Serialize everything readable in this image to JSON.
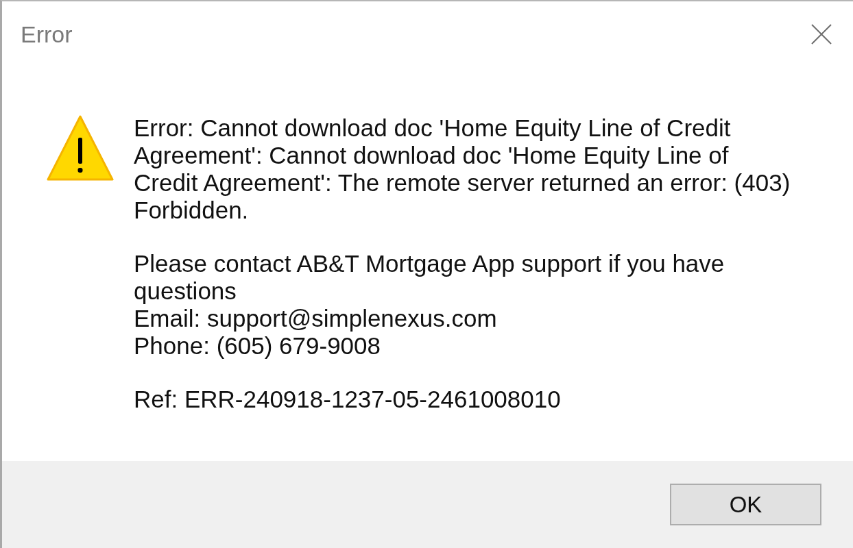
{
  "window": {
    "title": "Error"
  },
  "message": {
    "paragraphs": [
      {
        "lines": [
          "Error: Cannot download doc 'Home Equity Line of Credit Agreement': Cannot download doc 'Home Equity Line of Credit Agreement': The remote server returned an error: (403) Forbidden."
        ]
      },
      {
        "lines": [
          "Please contact AB&T Mortgage App support if you have questions",
          "Email: support@simplenexus.com",
          "Phone: (605) 679-9008"
        ]
      },
      {
        "lines": [
          "Ref: ERR-240918-1237-05-2461008010"
        ]
      }
    ]
  },
  "buttons": [
    {
      "label": "OK"
    }
  ]
}
